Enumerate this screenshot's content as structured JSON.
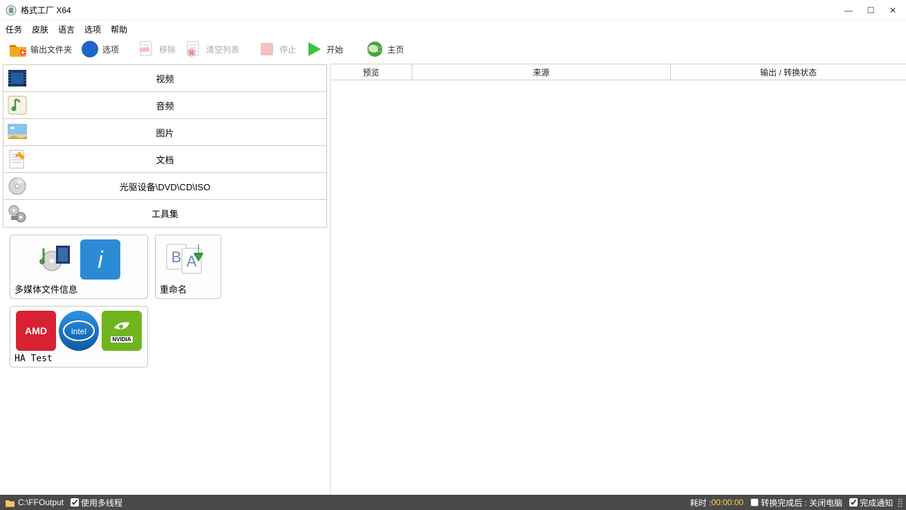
{
  "window": {
    "title": "格式工厂 X64"
  },
  "menu": {
    "items": [
      "任务",
      "皮肤",
      "语言",
      "选项",
      "帮助"
    ]
  },
  "toolbar": {
    "output_folder": "输出文件夹",
    "options": "选项",
    "remove": "移除",
    "clear_list": "清空列表",
    "stop": "停止",
    "start": "开始",
    "home": "主页"
  },
  "categories": [
    {
      "label": "视频"
    },
    {
      "label": "音频"
    },
    {
      "label": "图片"
    },
    {
      "label": "文档"
    },
    {
      "label": "光驱设备\\DVD\\CD\\ISO"
    },
    {
      "label": "工具集"
    }
  ],
  "tools": {
    "media_info": "多媒体文件信息",
    "rename": "重命名",
    "ha_test": "HA Test",
    "amd": "AMD",
    "intel": "intel",
    "nvidia": "NVIDIA"
  },
  "table": {
    "col_preview": "预览",
    "col_source": "来源",
    "col_output": "输出 / 转换状态"
  },
  "statusbar": {
    "path": "C:\\FFOutput",
    "multithread": "使用多线程",
    "elapsed_label": "耗时 : ",
    "elapsed_value": "00:00:00",
    "after_convert": "转换完成后 : 关闭电脑",
    "notify": "完成通知"
  }
}
